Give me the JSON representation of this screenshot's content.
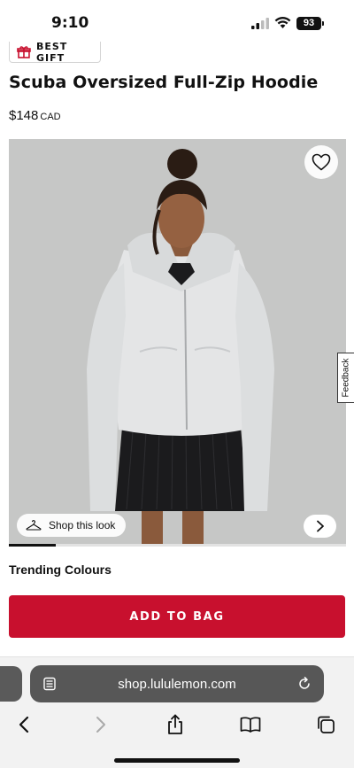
{
  "status_bar": {
    "time": "9:10",
    "battery": "93"
  },
  "badge": {
    "label": "BEST GIFT",
    "icon": "gift-icon"
  },
  "product": {
    "title": "Scuba Oversized Full-Zip Hoodie",
    "price": "$148",
    "currency": "CAD"
  },
  "gallery": {
    "shop_look_label": "Shop this look",
    "wishlist_icon": "heart-icon",
    "next_icon": "chevron-right-icon",
    "progress_fraction": 0.14
  },
  "feedback_tab": "Feedback",
  "colours_heading": "Trending Colours",
  "add_to_bag": "ADD TO BAG",
  "browser": {
    "url": "shop.lululemon.com",
    "toolbar_icons": [
      "back-icon",
      "forward-icon",
      "share-icon",
      "bookmarks-icon",
      "tabs-icon"
    ]
  },
  "colors": {
    "accent": "#c8102e",
    "image_bg": "#c6c7c6"
  }
}
